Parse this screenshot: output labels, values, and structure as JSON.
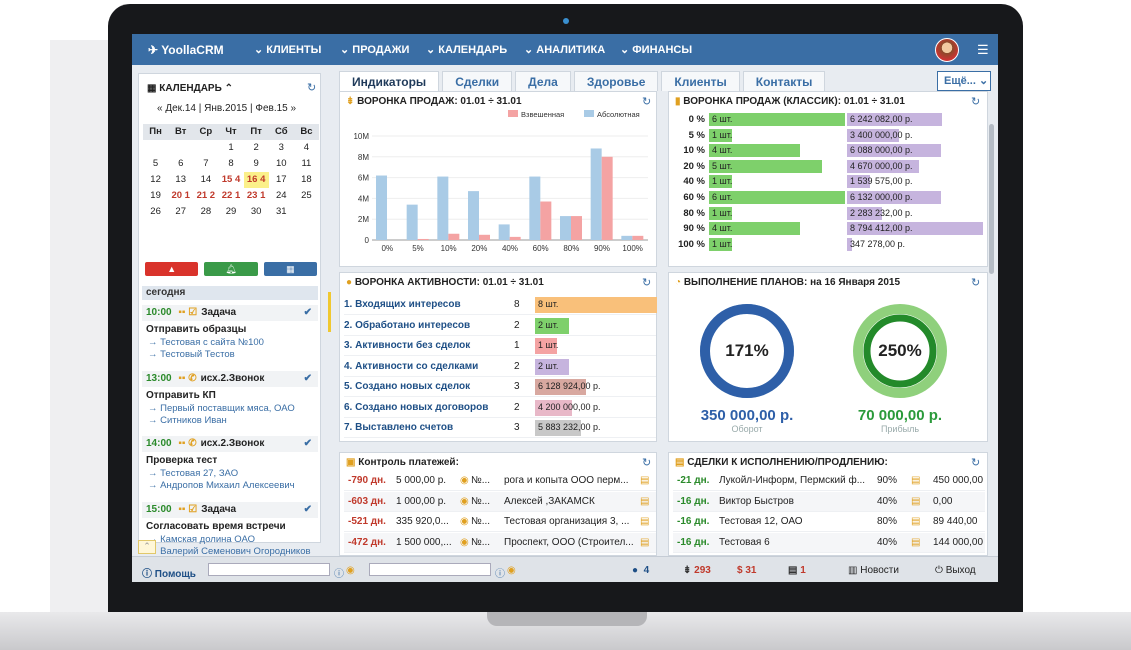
{
  "app": {
    "logo": "YoollaCRM"
  },
  "nav": [
    {
      "label": "КЛИЕНТЫ"
    },
    {
      "label": "ПРОДАЖИ"
    },
    {
      "label": "КАЛЕНДАРЬ"
    },
    {
      "label": "АНАЛИТИКА"
    },
    {
      "label": "ФИНАНСЫ"
    }
  ],
  "calendar": {
    "title": "КАЛЕНДАРЬ",
    "months": "« Дек.14 | Янв.2015 | Фев.15 »",
    "weekdays": [
      "Пн",
      "Вт",
      "Ср",
      "Чт",
      "Пт",
      "Сб",
      "Вс"
    ],
    "weeks": [
      [
        "",
        "",
        "",
        "1",
        "2",
        "3",
        "4"
      ],
      [
        "5",
        "6",
        "7",
        "8",
        "9",
        "10",
        "11"
      ],
      [
        "12",
        "13",
        "14",
        "15 4",
        "16 4",
        "17",
        "18"
      ],
      [
        "19",
        "20 1",
        "21 2",
        "22 1",
        "23 1",
        "24",
        "25"
      ],
      [
        "26",
        "27",
        "28",
        "29",
        "30",
        "31",
        ""
      ]
    ],
    "today_label": "сегодня"
  },
  "tasks": [
    {
      "time": "10:00",
      "type": "Задача",
      "title": "Отправить образцы",
      "links": [
        "→ Тестовая с сайта №100",
        "→ Тестовый Тестов"
      ]
    },
    {
      "time": "13:00",
      "type": "исх.2.Звонок",
      "title": "Отправить КП",
      "links": [
        "→ Первый поставщик мяса, ОАО",
        "→ Ситников Иван"
      ]
    },
    {
      "time": "14:00",
      "type": "исх.2.Звонок",
      "title": "Проверка тест",
      "links": [
        "→ Тестовая 27, ЗАО",
        "→ Андропов Михаил Алексеевич"
      ]
    },
    {
      "time": "15:00",
      "type": "Задача",
      "title": "Согласовать время встречи",
      "links": [
        "→ Камская долина ОАО",
        "→ Валерий Семенович Огородников"
      ]
    }
  ],
  "tabs": [
    {
      "label": "Индикаторы"
    },
    {
      "label": "Сделки"
    },
    {
      "label": "Дела"
    },
    {
      "label": "Здоровье"
    },
    {
      "label": "Клиенты"
    },
    {
      "label": "Контакты"
    }
  ],
  "more_label": "Ещё...",
  "funnel_chart": {
    "title": "ВОРОНКА ПРОДАЖ: 01.01 ÷ 31.01",
    "chart_data": {
      "type": "bar",
      "categories": [
        "0%",
        "5%",
        "10%",
        "20%",
        "40%",
        "60%",
        "80%",
        "90%",
        "100%"
      ],
      "series": [
        {
          "name": "Взвешенная",
          "values": [
            0,
            0.1,
            0.6,
            0.5,
            0.3,
            3.7,
            2.3,
            8.0,
            0.4
          ],
          "color": "#f4a3a3"
        },
        {
          "name": "Абсолютная",
          "values": [
            6.2,
            3.4,
            6.1,
            4.7,
            1.5,
            6.1,
            2.3,
            8.8,
            0.4
          ],
          "color": "#a9cbe6"
        }
      ],
      "yticks": [
        "0",
        "2M",
        "4M",
        "6M",
        "8M",
        "10M"
      ],
      "ylim": [
        0,
        10
      ]
    }
  },
  "funnel_classic": {
    "title": "ВОРОНКА ПРОДАЖ (КЛАССИК): 01.01 ÷ 31.01",
    "rows": [
      {
        "pct": "0 %",
        "count": "6 шт.",
        "sum": "6 242 082,00 р.",
        "count_frac": 1.0,
        "sum_frac": 0.7
      },
      {
        "pct": "5 %",
        "count": "1 шт.",
        "sum": "3 400 000,00 р.",
        "count_frac": 0.17,
        "sum_frac": 0.38
      },
      {
        "pct": "10 %",
        "count": "4 шт.",
        "sum": "6 088 000,00 р.",
        "count_frac": 0.67,
        "sum_frac": 0.69
      },
      {
        "pct": "20 %",
        "count": "5 шт.",
        "sum": "4 670 000,00 р.",
        "count_frac": 0.83,
        "sum_frac": 0.53
      },
      {
        "pct": "40 %",
        "count": "1 шт.",
        "sum": "1 539 575,00 р.",
        "count_frac": 0.17,
        "sum_frac": 0.17
      },
      {
        "pct": "60 %",
        "count": "6 шт.",
        "sum": "6 132 000,00 р.",
        "count_frac": 1.0,
        "sum_frac": 0.69
      },
      {
        "pct": "80 %",
        "count": "1 шт.",
        "sum": "2 283 232,00 р.",
        "count_frac": 0.17,
        "sum_frac": 0.26
      },
      {
        "pct": "90 %",
        "count": "4 шт.",
        "sum": "8 794 412,00 р.",
        "count_frac": 0.67,
        "sum_frac": 1.0
      },
      {
        "pct": "100 %",
        "count": "1 шт.",
        "sum": "347 278,00 р.",
        "count_frac": 0.17,
        "sum_frac": 0.04
      }
    ]
  },
  "activity": {
    "title": "ВОРОНКА АКТИВНОСТИ: 01.01 ÷ 31.01",
    "rows": [
      {
        "name": "1. Входящих интересов",
        "value": "8",
        "bar": "8 шт.",
        "frac": 1.0,
        "color": "#f9c07a"
      },
      {
        "name": "2. Обработано интересов",
        "value": "2",
        "bar": "2 шт.",
        "frac": 0.28,
        "color": "#7ed06b"
      },
      {
        "name": "3. Активности без сделок",
        "value": "1",
        "bar": "1 шт.",
        "frac": 0.18,
        "color": "#f4a3a3"
      },
      {
        "name": "4. Активности со сделками",
        "value": "2",
        "bar": "2 шт.",
        "frac": 0.28,
        "color": "#c6b4de"
      },
      {
        "name": "5. Создано новых сделок",
        "value": "3",
        "bar": "6 128 924,00 р.",
        "frac": 0.42,
        "color": "#d8a8a0"
      },
      {
        "name": "6. Создано новых договоров",
        "value": "2",
        "bar": "4 200 000,00 р.",
        "frac": 0.3,
        "color": "#e8b8c8"
      },
      {
        "name": "7. Выставлено счетов",
        "value": "3",
        "bar": "5 883 232,00 р.",
        "frac": 0.38,
        "color": "#c8c8c8"
      }
    ]
  },
  "plans": {
    "title": "ВЫПОЛНЕНИЕ ПЛАНОВ: на 16 Января 2015",
    "gauges": [
      {
        "pct": "171%",
        "money": "350 000,00 р.",
        "caption": "Оборот",
        "color": "#2e5fa8",
        "light": "#8fb4d8",
        "money_color": "#2e5fa8"
      },
      {
        "pct": "250%",
        "money": "70 000,00 р.",
        "caption": "Прибыль",
        "color": "#238a2a",
        "light": "#8fd07c",
        "money_color": "#2a9a3a"
      }
    ]
  },
  "payments": {
    "title": "Контроль платежей:",
    "rows": [
      {
        "days": "-790 дн.",
        "sum": "5 000,00 р.",
        "no": "№...",
        "client": "рога и копыта ООО перм..."
      },
      {
        "days": "-603 дн.",
        "sum": "1 000,00 р.",
        "no": "№...",
        "client": "Алексей ,ЗАКАМСК"
      },
      {
        "days": "-521 дн.",
        "sum": "335 920,0...",
        "no": "№...",
        "client": "Тестовая организация 3, ..."
      },
      {
        "days": "-472 дн.",
        "sum": "1 500 000,...",
        "no": "№...",
        "client": "Проспект, ООО (Строител..."
      }
    ]
  },
  "deals": {
    "title": "СДЕЛКИ К ИСПОЛНЕНИЮ/ПРОДЛЕНИЮ:",
    "rows": [
      {
        "days": "-21 дн.",
        "client": "Лукойл-Информ, Пермский ф...",
        "pct": "90%",
        "sum": "450 000,00"
      },
      {
        "days": "-16 дн.",
        "client": "Виктор Быстров",
        "pct": "40%",
        "sum": "0,00"
      },
      {
        "days": "-16 дн.",
        "client": "Тестовая 12, ОАО",
        "pct": "80%",
        "sum": "89 440,00"
      },
      {
        "days": "-16 дн.",
        "client": "Тестовая 6",
        "pct": "40%",
        "sum": "144 000,00"
      }
    ]
  },
  "bottom": {
    "help": "Помощь",
    "chat_count": "4",
    "funnel_count": "293",
    "money_count": "31",
    "case_count": "1",
    "news": "Новости",
    "exit": "Выход"
  }
}
